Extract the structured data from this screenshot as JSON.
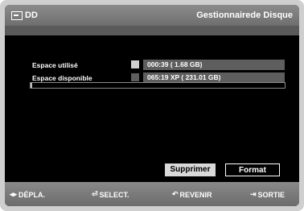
{
  "header": {
    "left_title": "DD",
    "right_title": "Gestionnairede Disque"
  },
  "info": {
    "rows": [
      {
        "label": "Espace utilisé",
        "value": "000:39       ( 1.68 GB)",
        "swatch_color": "#cfcfcf"
      },
      {
        "label": "Espace disponible",
        "value": "065:19 XP   ( 231.01 GB)",
        "swatch_color": "#5e5e5e"
      }
    ],
    "capacity_used_fraction": 0.007
  },
  "buttons": {
    "delete_label": "Supprimer",
    "format_label": "Format"
  },
  "footer": {
    "move_label": "DÉPLA.",
    "select_label": "SELECT.",
    "back_label": "REVENIR",
    "exit_label": "SORTIE"
  },
  "colors": {
    "title_bar": "#7b7b7b",
    "background": "#000000",
    "value_bg": "#5e5e5e"
  }
}
